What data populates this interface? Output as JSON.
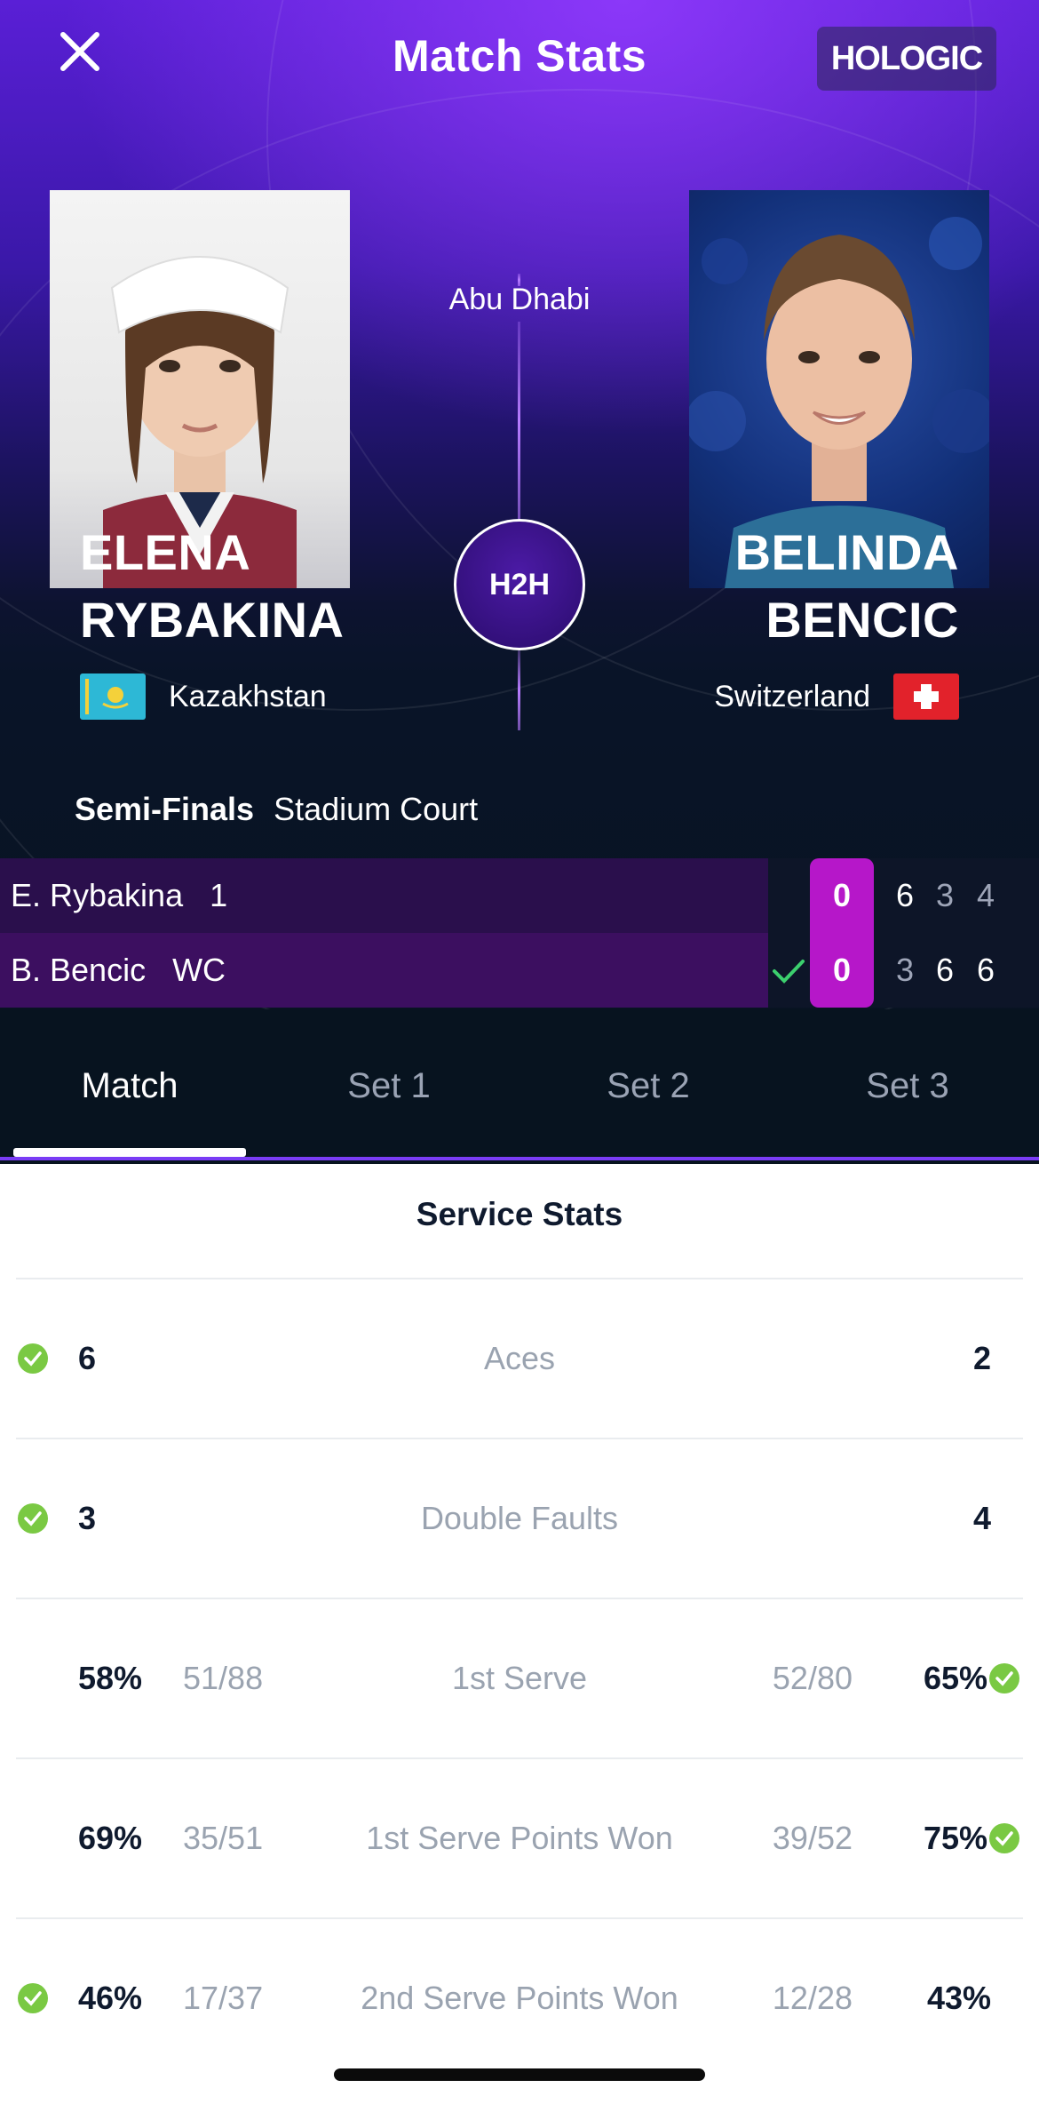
{
  "header": {
    "title": "Match Stats",
    "sponsor": "HOLOGIC"
  },
  "match": {
    "venue": "Abu Dhabi",
    "h2h_label": "H2H",
    "round": "Semi-Finals",
    "court": "Stadium Court"
  },
  "players": {
    "left": {
      "first": "ELENA",
      "last": "RYBAKINA",
      "country": "Kazakhstan"
    },
    "right": {
      "first": "BELINDA",
      "last": "BENCIC",
      "country": "Switzerland"
    }
  },
  "scoreboard": {
    "rows": [
      {
        "name": "E. Rybakina",
        "seed": "1",
        "game": "0",
        "sets": [
          "6",
          "3",
          "4"
        ],
        "set_won": [
          true,
          false,
          false
        ]
      },
      {
        "name": "B. Bencic",
        "seed": "WC",
        "game": "0",
        "sets": [
          "3",
          "6",
          "6"
        ],
        "set_won": [
          false,
          true,
          true
        ],
        "winner": true
      }
    ]
  },
  "tabs": [
    {
      "label": "Match",
      "active": true
    },
    {
      "label": "Set 1",
      "active": false
    },
    {
      "label": "Set 2",
      "active": false
    },
    {
      "label": "Set 3",
      "active": false
    }
  ],
  "service_stats": {
    "title": "Service Stats",
    "rows": [
      {
        "label": "Aces",
        "left": "6",
        "right": "2",
        "left_frac": "",
        "right_frac": "",
        "leader": "left"
      },
      {
        "label": "Double Faults",
        "left": "3",
        "right": "4",
        "left_frac": "",
        "right_frac": "",
        "leader": "left"
      },
      {
        "label": "1st Serve",
        "left": "58%",
        "right": "65%",
        "left_frac": "51/88",
        "right_frac": "52/80",
        "leader": "right"
      },
      {
        "label": "1st Serve Points Won",
        "left": "69%",
        "right": "75%",
        "left_frac": "35/51",
        "right_frac": "39/52",
        "leader": "right"
      },
      {
        "label": "2nd Serve Points Won",
        "left": "46%",
        "right": "43%",
        "left_frac": "17/37",
        "right_frac": "12/28",
        "leader": "left"
      }
    ]
  },
  "colors": {
    "accent_purple": "#b617c9",
    "check_green": "#7ac943",
    "tab_border": "#7a3cf5"
  }
}
